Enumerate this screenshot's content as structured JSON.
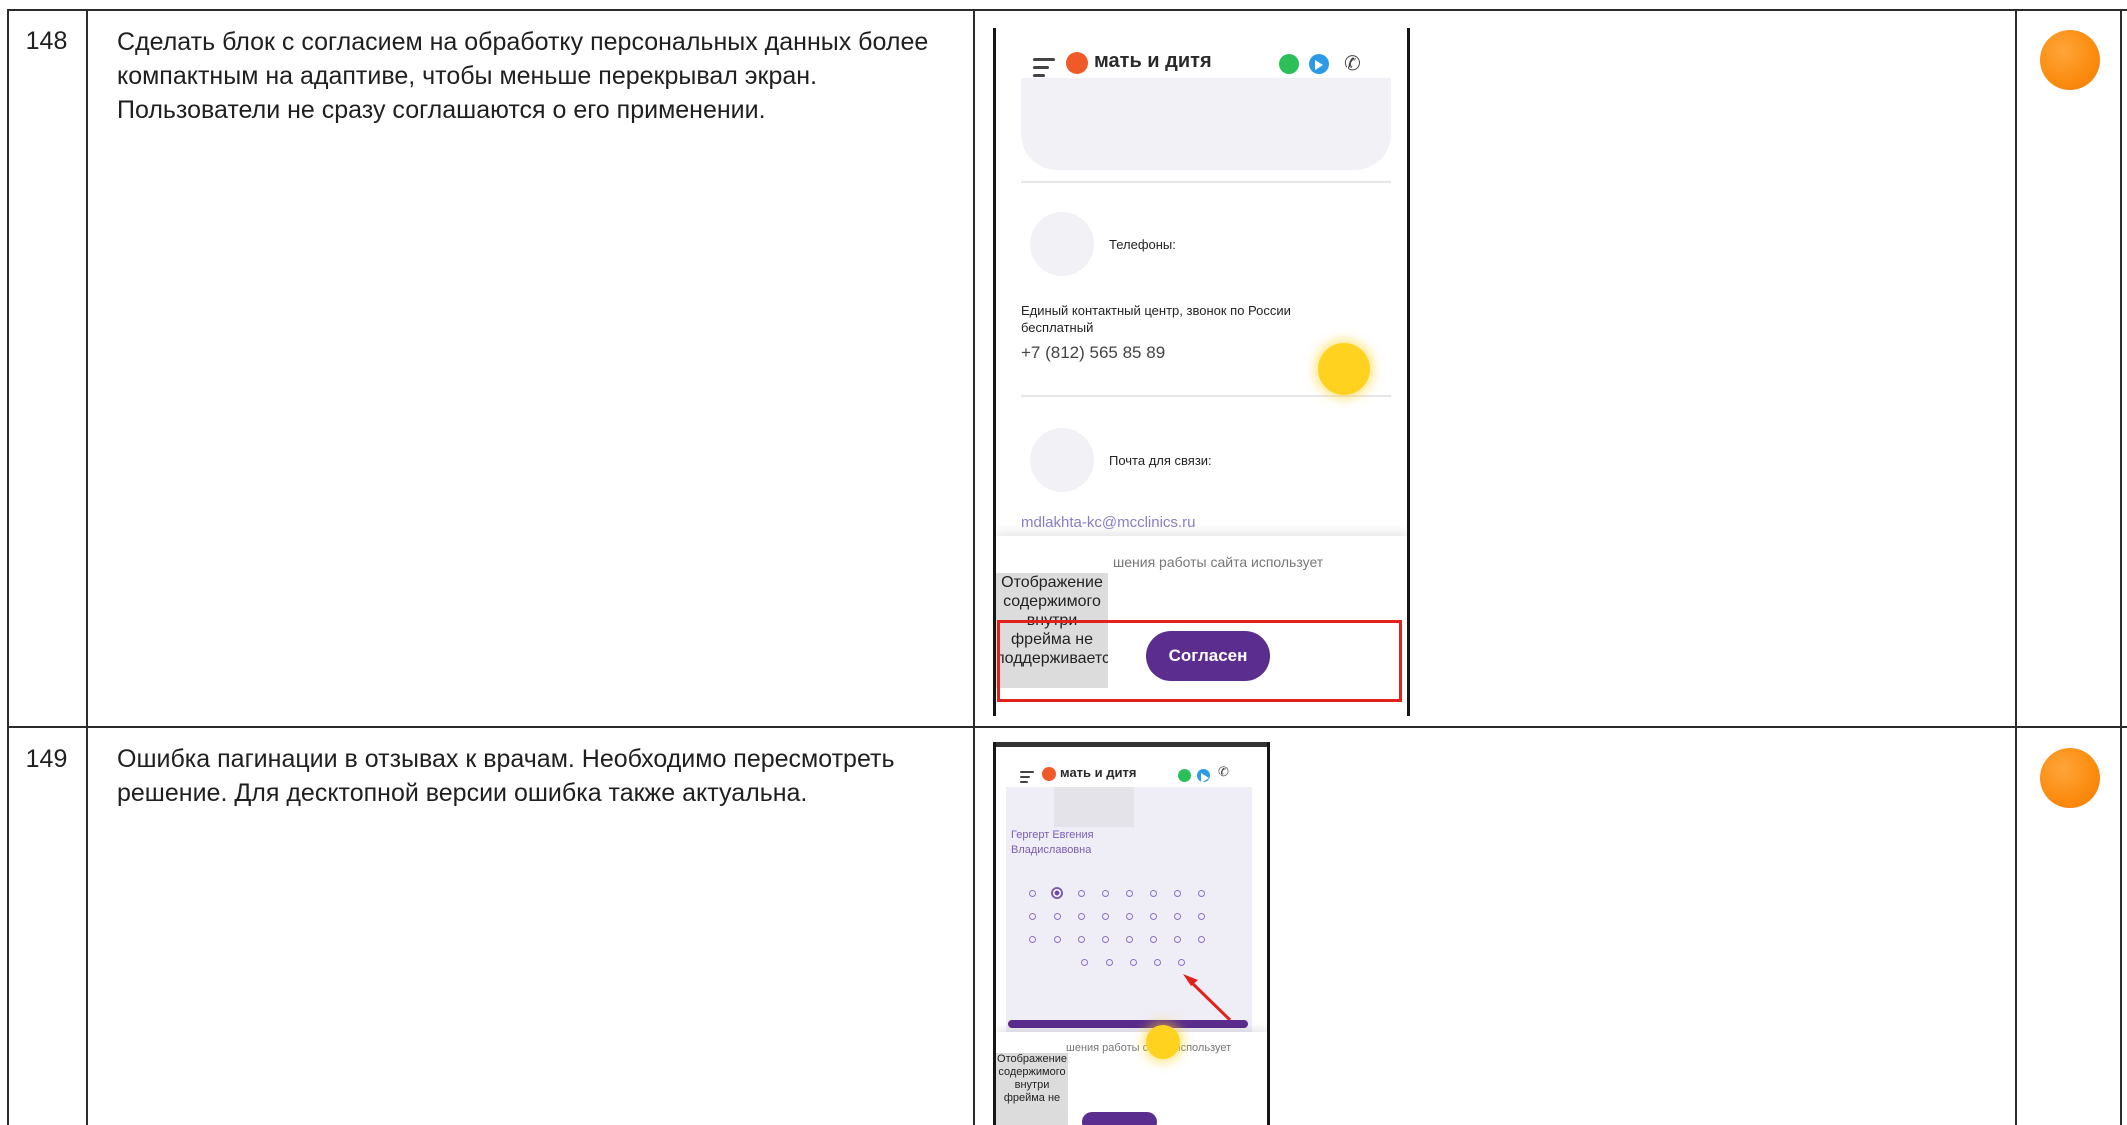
{
  "rows": [
    {
      "number": "148",
      "description": "Сделать блок с согласием на обработку персональных данных более компактным на адаптиве, чтобы меньше перекрывал экран. Пользователи не сразу соглашаются о его применении.",
      "status_color": "#fb8d11"
    },
    {
      "number": "149",
      "description": "Ошибка пагинации в отзывах к врачам. Необходимо пересмотреть решение. Для десктопной версии ошибка также актуальна.",
      "status_color": "#fb8d11"
    }
  ],
  "screenshot1": {
    "logo": "мать и дитя",
    "phones_label": "Телефоны:",
    "contact_center": "Единый контактный центр, звонок по России бесплатный",
    "phone_number": "+7 (812) 565 85 89",
    "email_label": "Почта для связи:",
    "email_partial": "mdlakhta-kc@mcclinics.ru",
    "cookie_text": "шения работы сайта использует",
    "iframe_text": "Отображение содержимого внутри фрейма не поддерживается",
    "accept_button": "Согласен"
  },
  "screenshot2": {
    "logo": "мать и дитя",
    "doctor_name": "Гергерт Евгения Владиславовна",
    "cookie_text": "шения работы сайта использует",
    "iframe_text": "Отображение содержимого внутри фрейма не"
  }
}
